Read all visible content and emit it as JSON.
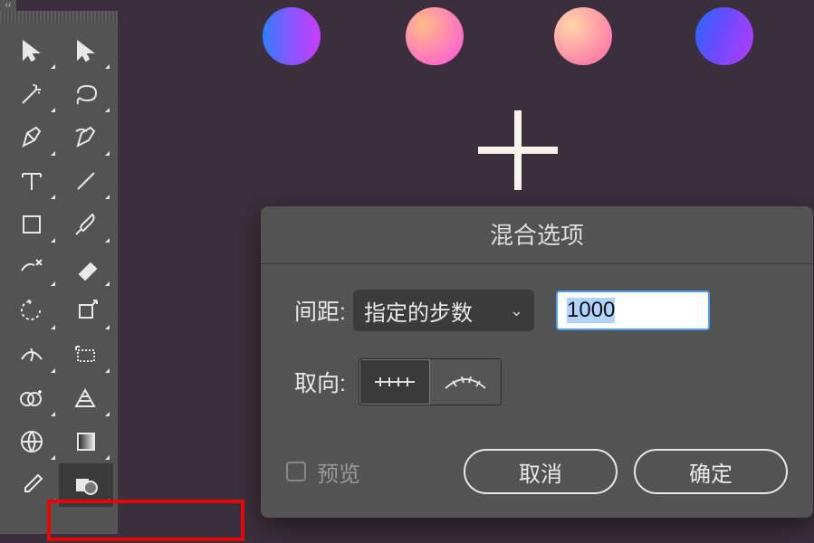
{
  "dialog": {
    "title": "混合选项",
    "spacing_label": "间距:",
    "spacing_mode": "指定的步数",
    "spacing_value": "1000",
    "orientation_label": "取向:",
    "preview_label": "预览",
    "cancel_label": "取消",
    "ok_label": "确定"
  },
  "tools": {
    "collapse": "‹‹"
  }
}
